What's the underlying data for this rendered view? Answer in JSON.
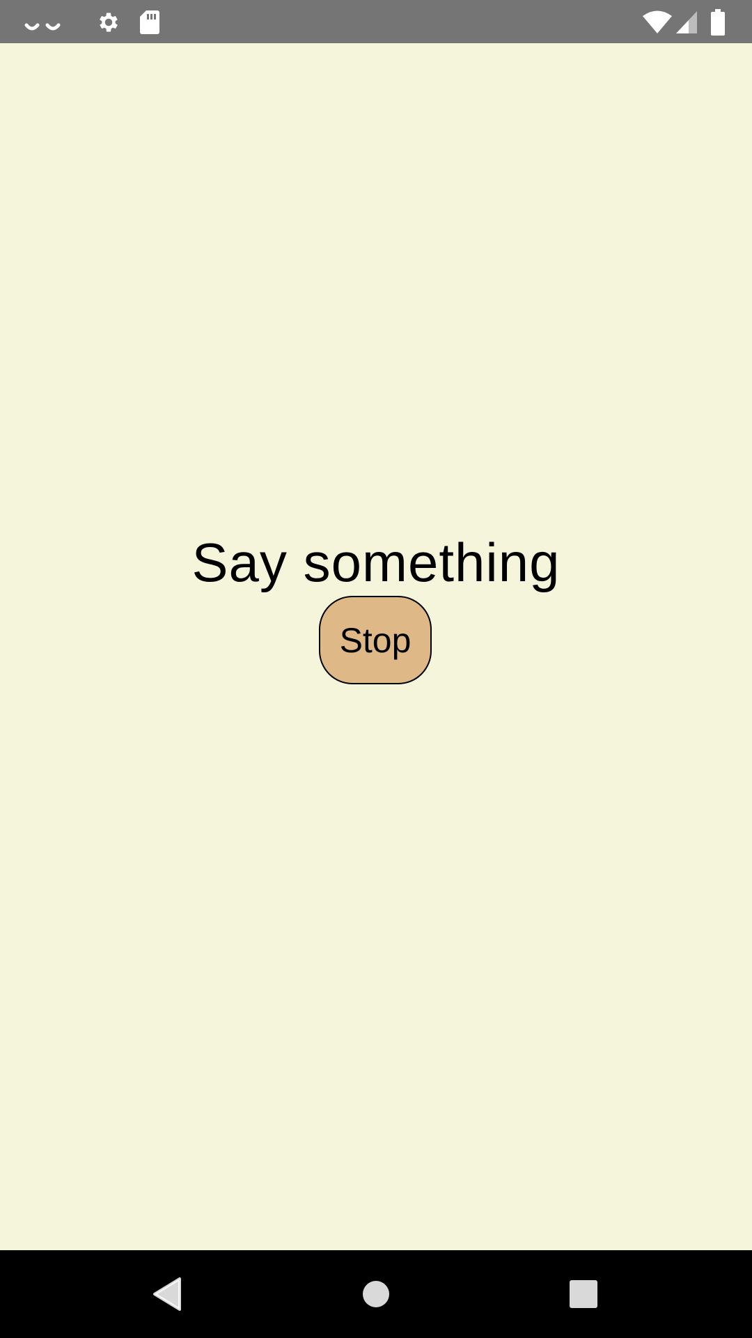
{
  "status_bar": {
    "left_icons": [
      "notification-dots-icon",
      "settings-gear-icon",
      "sd-card-icon"
    ],
    "right_icons": [
      "wifi-icon",
      "cell-signal-icon",
      "battery-icon"
    ],
    "background_color": "#757575"
  },
  "main": {
    "prompt_text": "Say something",
    "stop_button_label": "Stop",
    "background_color": "#f5f5dc",
    "button_color": "#deb887"
  },
  "nav_bar": {
    "buttons": [
      "back-icon",
      "home-icon",
      "recents-icon"
    ]
  }
}
